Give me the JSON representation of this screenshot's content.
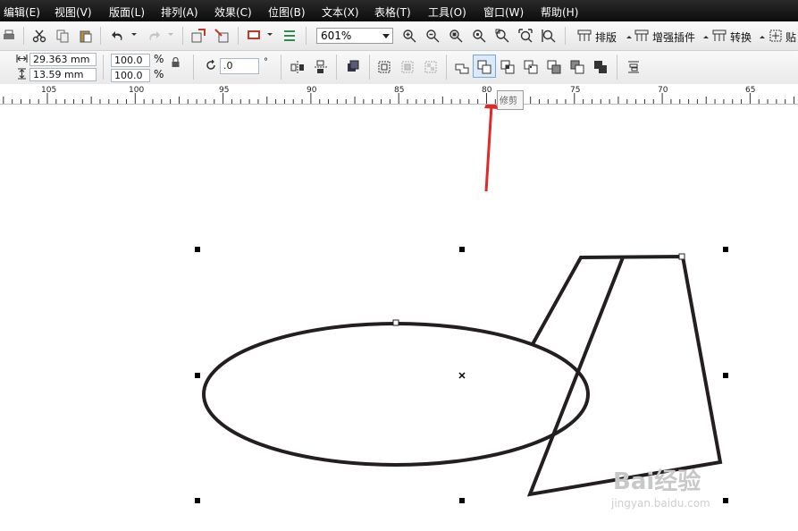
{
  "menu": {
    "items": [
      "编辑(E)",
      "视图(V)",
      "版面(L)",
      "排列(A)",
      "效果(C)",
      "位图(B)",
      "文本(X)",
      "表格(T)",
      "工具(O)",
      "窗口(W)",
      "帮助(H)"
    ]
  },
  "toolbar": {
    "zoom_value": "601%",
    "buttons": [
      "排版",
      "增强插件",
      "转换",
      "贴"
    ]
  },
  "property_bar": {
    "width": "29.363 mm",
    "height": "13.59 mm",
    "scale_x": "100.0",
    "scale_y": "100.0",
    "percent": "%",
    "rotation": ".0",
    "degree": "°"
  },
  "ruler": {
    "labels": [
      "105",
      "100",
      "95",
      "90",
      "85",
      "80",
      "75",
      "70",
      "65"
    ]
  },
  "tooltip": {
    "text": "修剪"
  },
  "watermark": {
    "brand": "Bai经验",
    "url": "jingyan.baidu.com"
  },
  "colors": {
    "menubar": "#111111",
    "arrow": "#e02a2a",
    "shape_stroke": "#231f20"
  }
}
